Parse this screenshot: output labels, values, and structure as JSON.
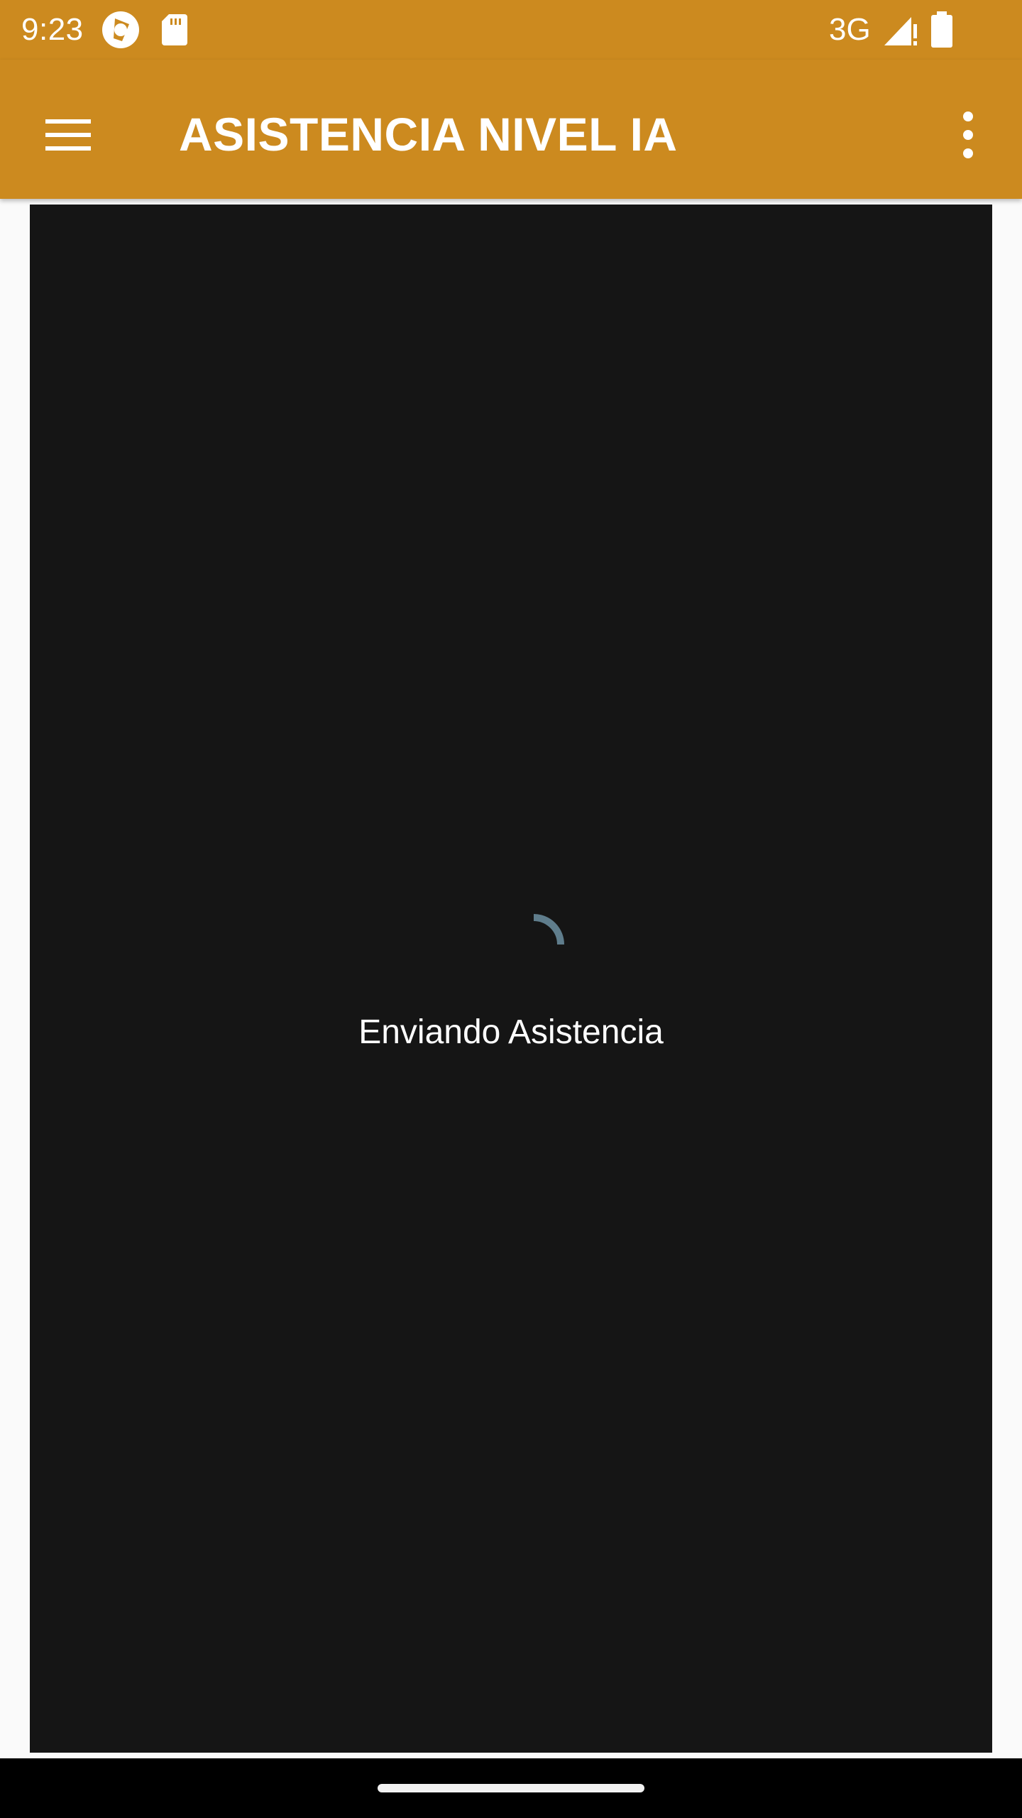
{
  "status_bar": {
    "time": "9:23",
    "network": "3G",
    "icons": [
      "app-notification-icon",
      "sd-card-icon",
      "signal-icon",
      "battery-icon"
    ]
  },
  "app_bar": {
    "title": "ASISTENCIA NIVEL IA",
    "color": "#cc8a1f",
    "icons": [
      "menu-icon",
      "more-vert-icon"
    ]
  },
  "content": {
    "background": "#151515",
    "spinner_color": "#5f7d8c",
    "loading_text": "Enviando Asistencia"
  }
}
